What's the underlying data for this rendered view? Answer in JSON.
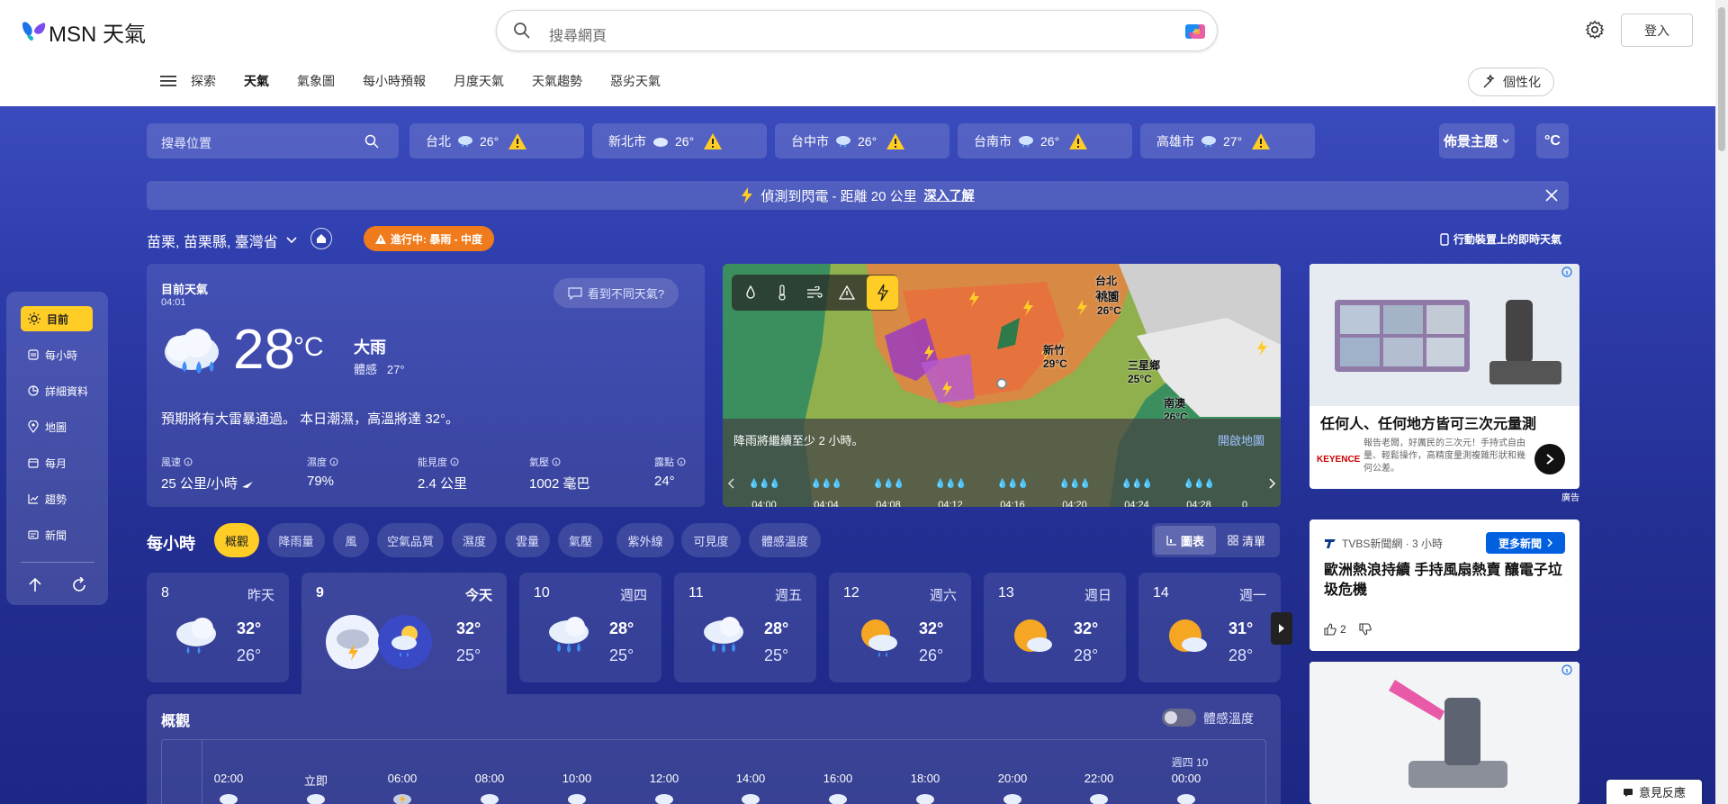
{
  "header": {
    "logo_text": "MSN 天氣",
    "search_placeholder": "搜尋網頁",
    "login_label": "登入",
    "personalize_label": "個性化",
    "nav": [
      "探索",
      "天氣",
      "氣象圖",
      "每小時預報",
      "月度天氣",
      "天氣趨勢",
      "惡劣天氣"
    ],
    "nav_active": "天氣"
  },
  "toolbar": {
    "location_search_placeholder": "搜尋位置",
    "cities": [
      {
        "name": "台北",
        "temp": "26°"
      },
      {
        "name": "新北市",
        "temp": "26°"
      },
      {
        "name": "台中市",
        "temp": "26°"
      },
      {
        "name": "台南市",
        "temp": "26°"
      },
      {
        "name": "高雄市",
        "temp": "27°"
      }
    ],
    "theme_label": "佈景主題",
    "unit_label": "°C"
  },
  "alert": {
    "text": "偵測到閃電 - 距離 20 公里",
    "link": "深入了解"
  },
  "location": {
    "name": "苗栗, 苗栗縣, 臺灣省",
    "in_progress": "進行中: 暴雨 - 中度",
    "mobile_label": "行動裝置上的即時天氣"
  },
  "sidebar": {
    "items": [
      "目前",
      "每小時",
      "詳細資料",
      "地圖",
      "每月",
      "趨勢",
      "新聞"
    ],
    "active": "目前"
  },
  "current": {
    "heading": "目前天氣",
    "time": "04:01",
    "different_label": "看到不同天氣?",
    "temp": "28",
    "unit": "°C",
    "condition": "大雨",
    "feels_label": "體感",
    "feels_value": "27°",
    "summary": "預期將有大雷暴通過。 本日潮濕，高溫將達 32°。",
    "metrics": [
      {
        "label": "風速",
        "value": "25 公里/小時"
      },
      {
        "label": "濕度",
        "value": "79%"
      },
      {
        "label": "能見度",
        "value": "2.4 公里"
      },
      {
        "label": "氣壓",
        "value": "1002 毫巴"
      },
      {
        "label": "露點",
        "value": "24°"
      }
    ]
  },
  "map": {
    "message": "降雨將繼續至少 2 小時。",
    "open_label": "開啟地圖",
    "times": [
      "04:00",
      "04:04",
      "04:08",
      "04:12",
      "04:16",
      "04:20",
      "04:24",
      "04:28",
      "0"
    ],
    "labels": [
      {
        "name": "台北",
        "temp": "26°C"
      },
      {
        "name": "桃園",
        "temp": "26°C"
      },
      {
        "name": "新竹",
        "temp": "29°C"
      },
      {
        "name": "三星鄉",
        "temp": "25°C"
      },
      {
        "name": "南澳",
        "temp": "26°C"
      }
    ]
  },
  "hourly": {
    "title": "每小時",
    "tabs": [
      "概觀",
      "降雨量",
      "風",
      "空氣品質",
      "濕度",
      "雲量",
      "氣壓",
      "紫外線",
      "可見度",
      "體感溫度"
    ],
    "active_tab": "概觀",
    "view_chart": "圖表",
    "view_list": "清單"
  },
  "days": [
    {
      "num": "8",
      "weekday": "昨天",
      "hi": "32°",
      "lo": "26°",
      "icon": "rain-cloud-icon"
    },
    {
      "num": "9",
      "weekday": "今天",
      "hi": "32°",
      "lo": "25°",
      "icon": "thunderstorm-icon"
    },
    {
      "num": "10",
      "weekday": "週四",
      "hi": "28°",
      "lo": "25°",
      "icon": "heavy-rain-icon"
    },
    {
      "num": "11",
      "weekday": "週五",
      "hi": "28°",
      "lo": "25°",
      "icon": "heavy-rain-icon"
    },
    {
      "num": "12",
      "weekday": "週六",
      "hi": "32°",
      "lo": "26°",
      "icon": "sun-rain-icon"
    },
    {
      "num": "13",
      "weekday": "週日",
      "hi": "32°",
      "lo": "28°",
      "icon": "partly-cloudy-icon"
    },
    {
      "num": "14",
      "weekday": "週一",
      "hi": "31°",
      "lo": "28°",
      "icon": "partly-cloudy-icon"
    }
  ],
  "overview": {
    "title": "概觀",
    "feels_toggle": "體感溫度",
    "next_day_label": "週四 10",
    "times": [
      "02:00",
      "立即",
      "06:00",
      "08:00",
      "10:00",
      "12:00",
      "14:00",
      "16:00",
      "18:00",
      "20:00",
      "22:00",
      "00:00"
    ]
  },
  "ads": {
    "ad1_title": "任何人、任何地方皆可三次元量測",
    "ad1_brand": "KEYENCE",
    "ad1_desc": "報告老闆，好厲民的三次元！手持式自由量、輕鬆操作，高精度量測複雜形狀和幾何公差。",
    "ad_label": "廣告"
  },
  "news": {
    "source": "TVBS新聞網 · 3 小時",
    "more_label": "更多新聞",
    "headline": "歐洲熱浪持續 手持風扇熱賣 釀電子垃圾危機",
    "likes": "2"
  },
  "feedback_label": "意見反應",
  "colors": {
    "accent": "#ffcd25",
    "alert_orange": "#f07b1d",
    "bg_top": "#3a4bbd",
    "bg_bottom": "#1d2785"
  }
}
